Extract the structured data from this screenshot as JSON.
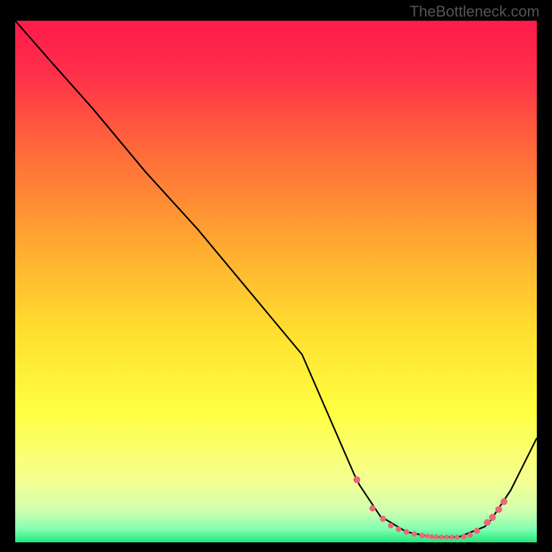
{
  "watermark": "TheBottleneck.com",
  "chart_data": {
    "type": "line",
    "title": "",
    "xlabel": "",
    "ylabel": "",
    "xlim": [
      0,
      100
    ],
    "ylim": [
      0,
      100
    ],
    "background_gradient": {
      "stops": [
        {
          "offset": 0.0,
          "color": "#ff1a4a"
        },
        {
          "offset": 0.1,
          "color": "#ff2f4a"
        },
        {
          "offset": 0.25,
          "color": "#ff6a3a"
        },
        {
          "offset": 0.45,
          "color": "#ffb030"
        },
        {
          "offset": 0.6,
          "color": "#ffe030"
        },
        {
          "offset": 0.75,
          "color": "#ffff40"
        },
        {
          "offset": 0.88,
          "color": "#f5ff90"
        },
        {
          "offset": 0.94,
          "color": "#d0ffb0"
        },
        {
          "offset": 0.975,
          "color": "#80ffb0"
        },
        {
          "offset": 1.0,
          "color": "#20e878"
        }
      ]
    },
    "series": [
      {
        "name": "bottleneck-curve",
        "color": "#000000",
        "x": [
          0,
          7,
          15,
          25,
          35,
          45,
          55,
          65,
          66,
          70,
          75,
          80,
          85,
          90,
          91,
          95,
          100
        ],
        "y": [
          100,
          92,
          83,
          71,
          60,
          48,
          36,
          13,
          11,
          5,
          2,
          1,
          1,
          3,
          4,
          10,
          20
        ]
      }
    ],
    "markers": {
      "name": "optimal-range-markers",
      "color": "#e86a78",
      "radius_default": 4.5,
      "points": [
        {
          "x": 65.5,
          "y": 12.0,
          "r": 5.0
        },
        {
          "x": 68.5,
          "y": 6.5,
          "r": 4.5
        },
        {
          "x": 70.5,
          "y": 4.5,
          "r": 4.5
        },
        {
          "x": 72.0,
          "y": 3.2,
          "r": 4.0
        },
        {
          "x": 73.5,
          "y": 2.5,
          "r": 4.0
        },
        {
          "x": 75.0,
          "y": 2.0,
          "r": 4.0
        },
        {
          "x": 76.5,
          "y": 1.6,
          "r": 4.0
        },
        {
          "x": 78.0,
          "y": 1.3,
          "r": 4.0
        },
        {
          "x": 79.0,
          "y": 1.2,
          "r": 3.5
        },
        {
          "x": 79.8,
          "y": 1.1,
          "r": 3.5
        },
        {
          "x": 80.7,
          "y": 1.05,
          "r": 3.5
        },
        {
          "x": 81.7,
          "y": 1.02,
          "r": 3.5
        },
        {
          "x": 82.7,
          "y": 1.0,
          "r": 3.5
        },
        {
          "x": 83.7,
          "y": 1.0,
          "r": 3.5
        },
        {
          "x": 84.7,
          "y": 1.0,
          "r": 3.5
        },
        {
          "x": 86.0,
          "y": 1.1,
          "r": 4.0
        },
        {
          "x": 87.2,
          "y": 1.4,
          "r": 4.0
        },
        {
          "x": 88.5,
          "y": 2.2,
          "r": 4.5
        },
        {
          "x": 90.5,
          "y": 3.8,
          "r": 5.0
        },
        {
          "x": 91.5,
          "y": 4.8,
          "r": 5.0
        },
        {
          "x": 92.7,
          "y": 6.3,
          "r": 5.0
        },
        {
          "x": 93.7,
          "y": 7.8,
          "r": 5.0
        }
      ]
    }
  }
}
